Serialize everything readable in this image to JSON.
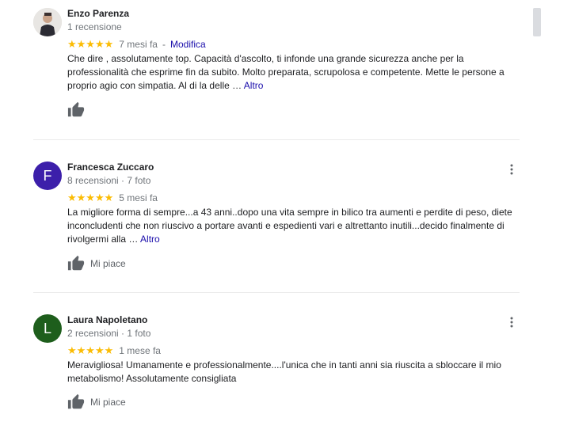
{
  "reviews": [
    {
      "name": "Enzo Parenza",
      "meta": "1 recensione",
      "stars": "★★★★★",
      "time": "7 mesi fa",
      "action_sep": "-",
      "action": "Modifica",
      "text": "Che dire , assolutamente top. Capacità d'ascolto, ti infonde una grande sicurezza anche per la professionalità che esprime fin da subito. Molto preparata, scrupolosa e competente. Mette le persone a proprio agio con simpatia. Al di la delle … ",
      "more": "Altro",
      "like_label": ""
    },
    {
      "name": "Francesca Zuccaro",
      "meta": "8 recensioni · 7 foto",
      "initial": "F",
      "avatar_color": "#3c1faa",
      "stars": "★★★★★",
      "time": "5 mesi fa",
      "text": "La migliore forma di sempre...a 43 anni..dopo una vita sempre in bilico tra aumenti e perdite di peso, diete inconcludenti che non riuscivo a portare avanti e espedienti vari e altrettanto inutili...decido finalmente di rivolgermi alla … ",
      "more": "Altro",
      "like_label": "Mi piace"
    },
    {
      "name": "Laura Napoletano",
      "meta": "2 recensioni · 1 foto",
      "initial": "L",
      "avatar_color": "#1e5e1c",
      "stars": "★★★★★",
      "time": "1 mese fa",
      "text": "Meravigliosa! Umanamente e professionalmente....l'unica che in tanti anni sia riuscita a sbloccare il mio metabolismo! Assolutamente consigliata",
      "like_label": "Mi piace"
    }
  ],
  "colors": {
    "star": "#fbbc04",
    "link": "#1a0dab",
    "muted": "#70757a"
  }
}
